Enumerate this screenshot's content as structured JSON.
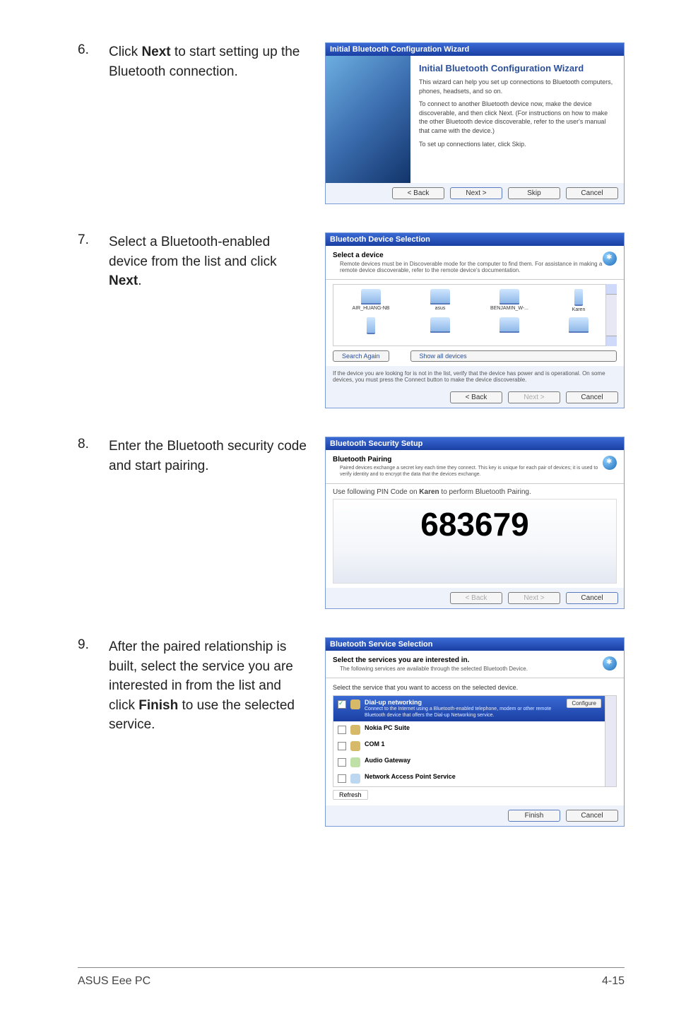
{
  "steps": {
    "s6": {
      "num": "6.",
      "text_pre": "Click ",
      "text_bold": "Next",
      "text_post": " to start setting up the Bluetooth connection.",
      "dialog": {
        "title": "Initial Bluetooth Configuration Wizard",
        "heading": "Initial Bluetooth Configuration Wizard",
        "p1": "This wizard can help you set up connections to Bluetooth computers, phones, headsets, and so on.",
        "p2": "To connect to another Bluetooth device now, make the device discoverable, and then click Next. (For instructions on how to make the other Bluetooth device discoverable, refer to the user's manual that came with the device.)",
        "p3": "To set up connections later, click Skip.",
        "btns": {
          "back": "< Back",
          "next": "Next >",
          "skip": "Skip",
          "cancel": "Cancel"
        }
      }
    },
    "s7": {
      "num": "7.",
      "text_pre": "Select a Bluetooth-enabled device from the list and click ",
      "text_bold": "Next",
      "text_post": ".",
      "dialog": {
        "title": "Bluetooth Device Selection",
        "header_b": "Select a device",
        "header_p": "Remote devices must be in Discoverable mode for the computer to find them. For assistance in making a remote device discoverable, refer to the remote device's documentation.",
        "devices": [
          "AIR_HUANG-NB",
          "asus",
          "BENJAMIN_W-...",
          "Karen",
          "",
          "",
          "",
          ""
        ],
        "search_again": "Search Again",
        "show_all": "Show all devices",
        "note": "If the device you are looking for is not in the list, verify that the device has power and is operational. On some devices, you must press the Connect button to make the device discoverable.",
        "btns": {
          "back": "< Back",
          "next": "Next >",
          "cancel": "Cancel"
        }
      }
    },
    "s8": {
      "num": "8.",
      "text": "Enter the Bluetooth security code and start pairing.",
      "dialog": {
        "title": "Bluetooth Security Setup",
        "header_b": "Bluetooth Pairing",
        "header_p": "Paired devices exchange a secret key each time they connect. This key is unique for each pair of devices; it is used to verify identity and to encrypt the data that the devices exchange.",
        "pin_note_pre": "Use following PIN Code on ",
        "pin_note_name": "Karen",
        "pin_note_post": " to perform Bluetooth Pairing.",
        "pin": "683679",
        "btns": {
          "back": "< Back",
          "next": "Next >",
          "cancel": "Cancel"
        }
      }
    },
    "s9": {
      "num": "9.",
      "text_pre": "After the paired relationship is built, select the service you are interested in from the list and click ",
      "text_bold": "Finish",
      "text_post": " to use the selected service.",
      "dialog": {
        "title": "Bluetooth Service Selection",
        "header_b": "Select the services you are interested in.",
        "header_p": "The following services are available through the selected Bluetooth Device.",
        "list_note": "Select the service that you want to access on the selected device.",
        "services": {
          "dial": {
            "name": "Dial-up networking",
            "desc": "Connect to the Internet using a Bluetooth-enabled telephone, modem or other remote Bluetooth device that offers the Dial-up Networking service.",
            "configure": "Configure"
          },
          "nokia": "Nokia PC Suite",
          "com": "COM 1",
          "audio": "Audio Gateway",
          "nap": "Network Access Point Service"
        },
        "refresh": "Refresh",
        "btns": {
          "finish": "Finish",
          "cancel": "Cancel"
        }
      }
    }
  },
  "footer": {
    "left": "ASUS Eee PC",
    "right": "4-15"
  }
}
